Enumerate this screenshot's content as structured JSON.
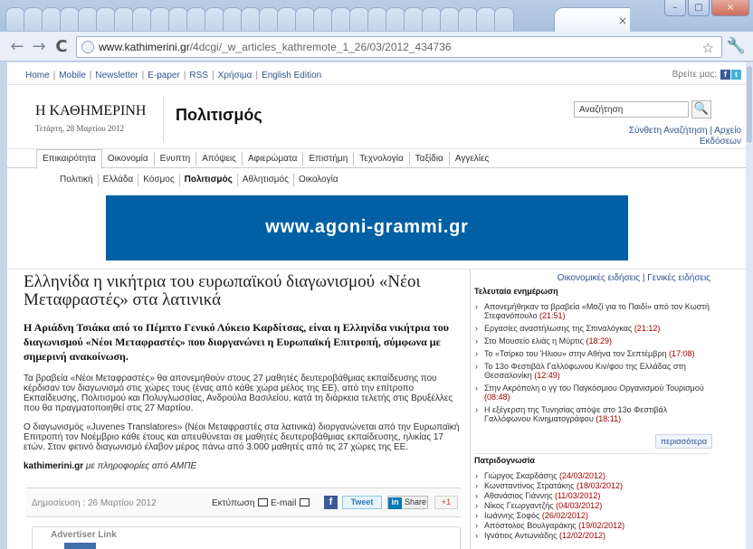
{
  "browser": {
    "url_main": "www.kathimerini.gr",
    "url_path": "/4dcgi/_w_articles_kathremote_1_26/03/2012_434736",
    "tab_close": "×",
    "win_min": "–",
    "win_max": "□",
    "win_close": "×",
    "back_icon": "←",
    "forward_icon": "→",
    "reload_icon": "C",
    "star_icon": "☆",
    "wrench_icon": "🔧"
  },
  "header": {
    "top_links": [
      "Home",
      "Mobile",
      "Newsletter",
      "E-paper",
      "RSS",
      "Χρήσιμα",
      "English Edition"
    ],
    "follow_text": "Βρείτε μας:",
    "fb": "f",
    "tw": "t",
    "brand_logo": "Η ΚΑΘΗΜΕΡΙΝΗ",
    "brand_date": "Τετάρτη, 28 Μαρτίου 2012",
    "section_title": "Πολιτισμός",
    "search_value": "Αναζήτηση",
    "search_icon": "🔍",
    "advanced_search": "Σύνθετη Αναζήτηση | Αρχείο Εκδόσεων"
  },
  "nav": {
    "main_items": [
      "Επικαιρότητα",
      "Οικονομία",
      "Ενυπτη",
      "Απόψεις",
      "Αφιερώματα",
      "Επιστήμη",
      "Τεχνολογία",
      "Ταξίδια",
      "Αγγελίες"
    ],
    "sub_items": [
      "Πολιτική",
      "Ελλάδα",
      "Κόσμος",
      "Πολιτισμός",
      "Αθλητισμός",
      "Οικολογία"
    ]
  },
  "banner": {
    "text": "www.agoni-grammi.gr"
  },
  "article": {
    "title": "Ελληνίδα η νικήτρια του ευρωπαϊκού διαγωνισμού «Νέοι Μεταφραστές» στα λατινικά",
    "lede": "Η Αριάδνη Τσιάκα από το Πέμπτο Γενικό Λύκειο Καρδίτσας, είναι η Ελληνίδα νικήτρια του διαγωνισμού «Νέοι Μεταφραστές» που διοργανώνει η Ευρωπαϊκή Επιτροπή, σύμφωνα με σημερινή ανακοίνωση.",
    "p1": "Τα βραβεία «Νέοι Μεταφραστές» θα απονεμηθούν στους 27 μαθητές δευτεροβάθμιας εκπαίδευσης που κέρδισαν τον διαγωνισμό στις χώρες τους (ένας από κάθε χώρα μέλος της ΕΕ), από την επίτροπο Εκπαίδευσης, Πολιτισμού και Πολυγλωσσίας, Ανδρούλα Βασιλείου, κατά τη διάρκεια τελετής στις Βρυξέλλες που θα πραγματοποιηθεί στις 27 Μαρτίου.",
    "p2": "Ο διαγωνισμός «Juvenes Translatores» (Νέοι Μεταφραστές στα λατινικά) διοργανώνεται από την Ευρωπαϊκή Επιτροπή τον Νοέμβριο κάθε έτους και απευθύνεται σε μαθητές δευτεροβάθμιας εκπαίδευσης, ηλικίας 17 ετών. Στον φετινό διαγωνισμό έλαβον μέρος πάνω από 3.000 μαθητές από τις 27 χώρες της ΕΕ.",
    "source_site": "kathimerini.gr",
    "source_text": "με πληροφορίες από ΑΜΠΕ",
    "published": "Δημοσίευση : 26 Μαρτίου 2012",
    "print_label": "Εκτύπωση",
    "email_label": "E-mail",
    "fb_share": "f",
    "tweet": "Tweet",
    "share": "Share",
    "gplus": "+1",
    "advertiser_link": "Advertiser Link"
  },
  "sidebar": {
    "top_links": "Οικονομικές ειδήσεις | Γενικές ειδήσεις",
    "latest_title": "Τελευταία ενημέρωση",
    "latest": [
      {
        "title": "Απονεμήθηκαν τα βραβεία «Μαζί για το Παιδί» από τον Κωστή Στεφανόπουλο",
        "time": "(21:51)"
      },
      {
        "title": "Εργασίες αναστήλωσης της Σπιναλόγκας",
        "time": "(21:12)"
      },
      {
        "title": "Στο Μουσείο ελιάς η Μύρτις",
        "time": "(18:29)"
      },
      {
        "title": "Το «Τσίρκο του Ήλιου» στην Αθήνα τον Σεπτέμβρη",
        "time": "(17:08)"
      },
      {
        "title": "Το 13ο Φεστιβάλ Γαλλόφωνου Κιν/φου της Ελλάδας στη Θεσσαλονίκη",
        "time": "(12:49)"
      },
      {
        "title": "Στην Ακρόπολη ο γγ του Παγκόσμιου Οργανισμού Τουρισμού",
        "time": "(08:48)"
      },
      {
        "title": "Η εξέγερση της Τυνησίας απόψε στο 13ο Φεστιβάλ Γαλλόφωνου Κινηματογράφου",
        "time": "(18:11)"
      }
    ],
    "more": "περισσότερα",
    "columns_title": "Πατριδογνωσία",
    "columns": [
      {
        "name": "Γιώργος Σκαρδάσης",
        "date": "(24/03/2012)"
      },
      {
        "name": "Κωνσταντίνος Στρατάκης",
        "date": "(18/03/2012)"
      },
      {
        "name": "Αθανάσιος Γιάννης",
        "date": "(11/03/2012)"
      },
      {
        "name": "Νίκος Γεωργαντζής",
        "date": "(04/03/2012)"
      },
      {
        "name": "Ιωάννης Σοφός",
        "date": "(26/02/2012)"
      },
      {
        "name": "Απόστολος Βουλγαράκης",
        "date": "(19/02/2012)"
      },
      {
        "name": "Ιγνάτιος Αντωνιάδης",
        "date": "(12/02/2012)"
      }
    ]
  }
}
